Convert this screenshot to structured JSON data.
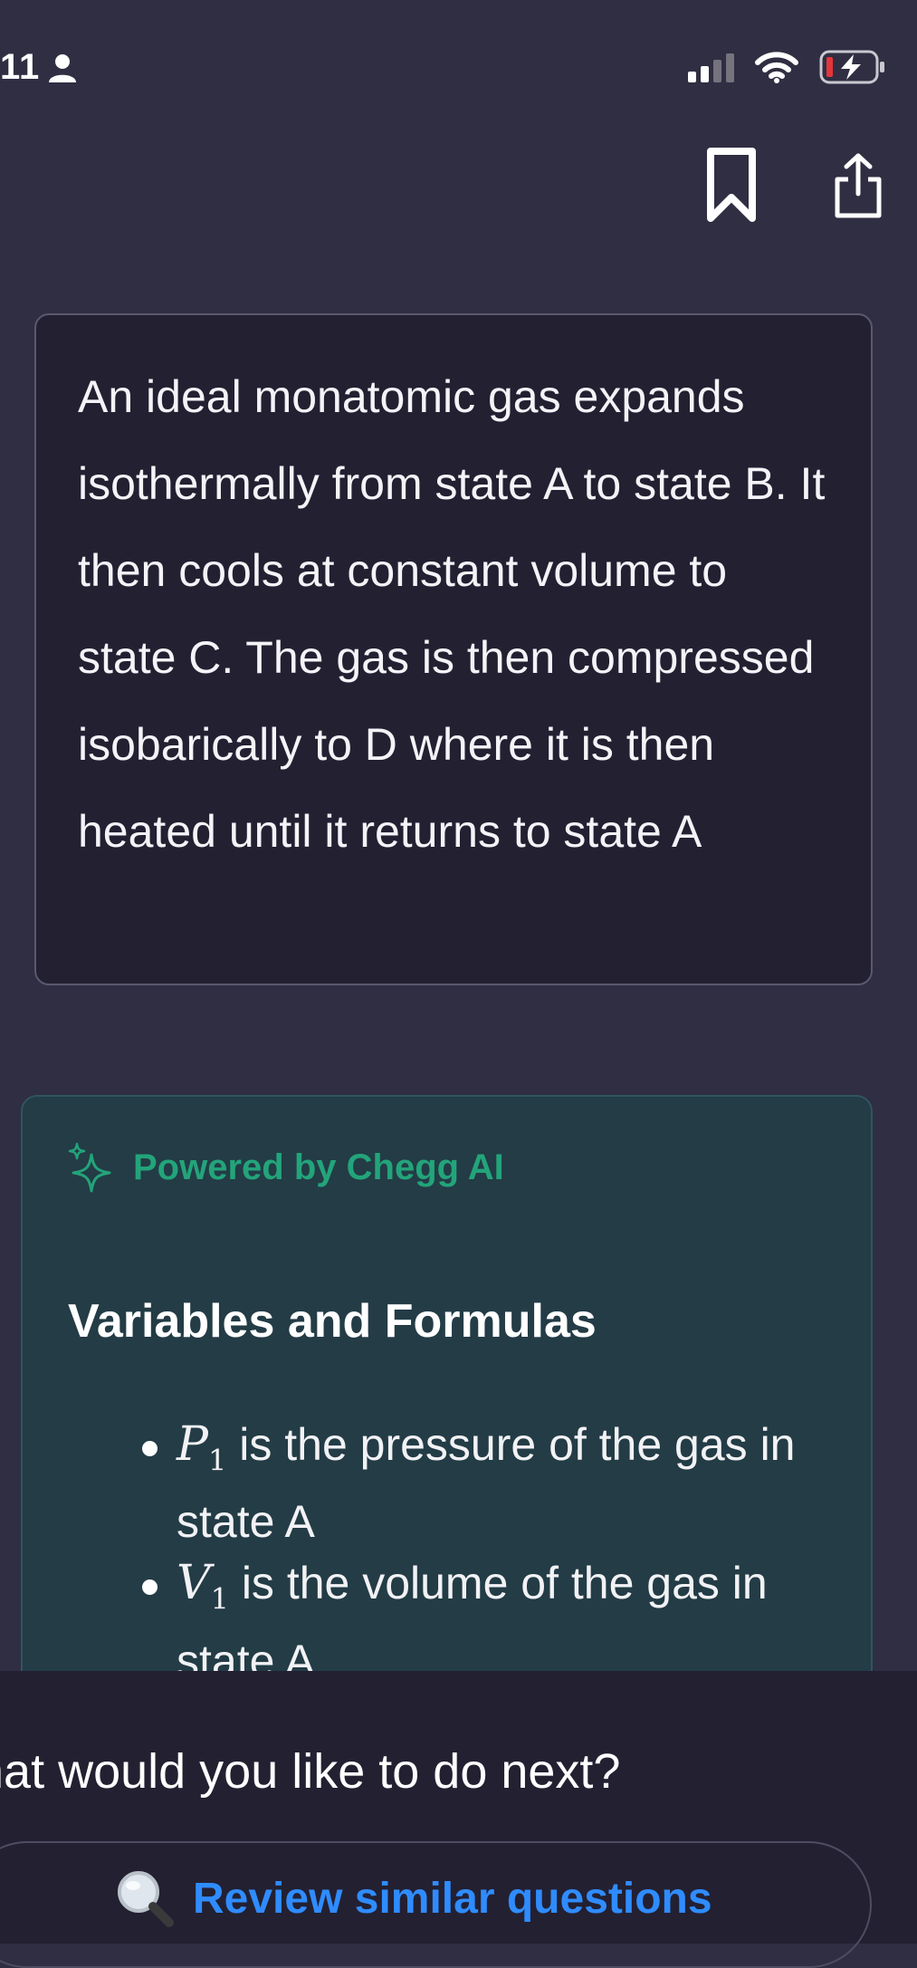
{
  "status_bar": {
    "time": "11"
  },
  "question": {
    "text": "An ideal monatomic gas expands isothermally from state A to state B. It then cools at constant volume to state C. The gas is then compressed isobarically to D where it is then heated until it returns to state A"
  },
  "ai_answer": {
    "powered_label": "Powered by Chegg AI",
    "section_title": "Variables and Formulas",
    "variables": [
      {
        "symbol": "P",
        "subscript": "1",
        "text": " is the pressure of the gas in state A"
      },
      {
        "symbol": "V",
        "subscript": "1",
        "text": " is the volume of the gas in state A"
      }
    ]
  },
  "next": {
    "title": "hat would you like to do next?",
    "review_button": "Review similar questions"
  },
  "colors": {
    "background": "#302e42",
    "card": "#232032",
    "ai_card": "#233c46",
    "accent_green": "#23a47a",
    "link_blue": "#2f8cff"
  }
}
